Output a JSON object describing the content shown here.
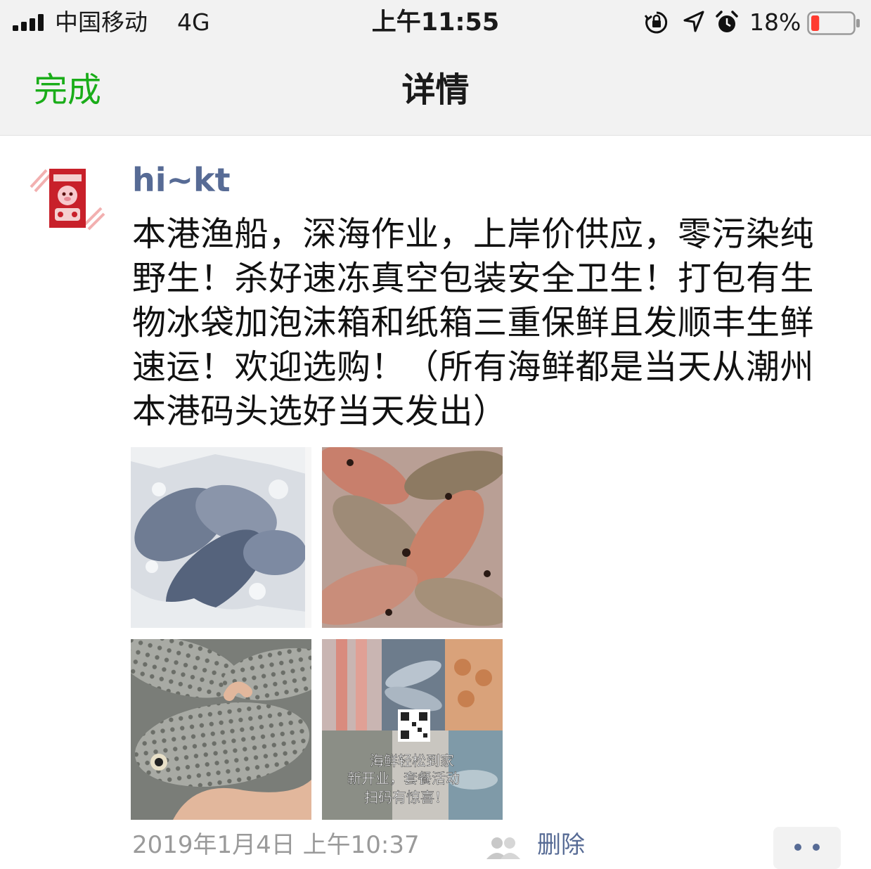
{
  "status_bar": {
    "carrier": "中国移动",
    "network": "4G",
    "time": "上午11:55",
    "battery_percent": "18%",
    "battery_level": 0.18,
    "battery_color": "#ff3b30",
    "icons": [
      "signal-icon",
      "orientation-lock-icon",
      "location-icon",
      "alarm-icon",
      "battery-icon"
    ]
  },
  "nav": {
    "done_label": "完成",
    "title": "详情"
  },
  "post": {
    "username": "hi~kt",
    "text": "本港渔船，深海作业，上岸价供应，零污染纯野生！杀好速冻真空包装安全卫生！打包有生物冰袋加泡沫箱和纸箱三重保鲜且发顺丰生鲜速运！欢迎选购！（所有海鲜都是当天从潮州本港码头选好当天发出）",
    "photos": [
      {
        "name": "photo-fish-on-ice"
      },
      {
        "name": "photo-red-fish"
      },
      {
        "name": "photo-spotted-fish"
      },
      {
        "name": "photo-seafood-collage"
      }
    ],
    "poster_caption": [
      "海鲜轻松到家",
      "新开业，套餐活动",
      "扫码有惊喜！"
    ],
    "time": "2019年1月4日 上午10:37",
    "delete_label": "删除",
    "visibility_icon": "friends-icon",
    "more_icon": "more-dots-icon"
  },
  "colors": {
    "accent_green": "#1aad19",
    "link_blue": "#576b95",
    "bar_bg": "#f2f2f2",
    "meta_gray": "#9a9a9a"
  }
}
